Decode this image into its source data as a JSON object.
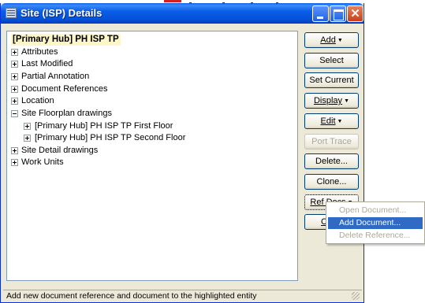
{
  "window": {
    "title": "Site (ISP) Details",
    "status_text": "Add new document reference and document to the highlighted entity"
  },
  "tree": {
    "root": "[Primary Hub] PH ISP TP",
    "items": [
      {
        "label": "Attributes",
        "expanded": false
      },
      {
        "label": "Last Modified",
        "expanded": false
      },
      {
        "label": "Partial Annotation",
        "expanded": false
      },
      {
        "label": "Document References",
        "expanded": false
      },
      {
        "label": "Location",
        "expanded": false
      },
      {
        "label": "Site Floorplan drawings",
        "expanded": true
      },
      {
        "label": "[Primary Hub] PH ISP TP First Floor",
        "expanded": false
      },
      {
        "label": "[Primary Hub] PH ISP TP Second Floor",
        "expanded": false
      },
      {
        "label": "Site Detail drawings",
        "expanded": false
      },
      {
        "label": "Work Units",
        "expanded": false
      }
    ]
  },
  "buttons": {
    "add": "Add",
    "select": "Select",
    "set_current": "Set Current",
    "display": "Display",
    "edit": "Edit",
    "port_trace": "Port Trace",
    "delete": "Delete...",
    "clone": "Clone...",
    "ref_docs": "Ref Docs",
    "hidden_first_letter": "C"
  },
  "context_menu": {
    "items": [
      {
        "label": "Open Document...",
        "state": "disabled"
      },
      {
        "label": "Add Document...",
        "state": "highlighted"
      },
      {
        "label": "Delete Reference...",
        "state": "disabled"
      }
    ]
  },
  "colors": {
    "title_bar": "#0a5ce8",
    "menu_highlight": "#316ac5",
    "root_highlight": "#fdf6c8"
  }
}
